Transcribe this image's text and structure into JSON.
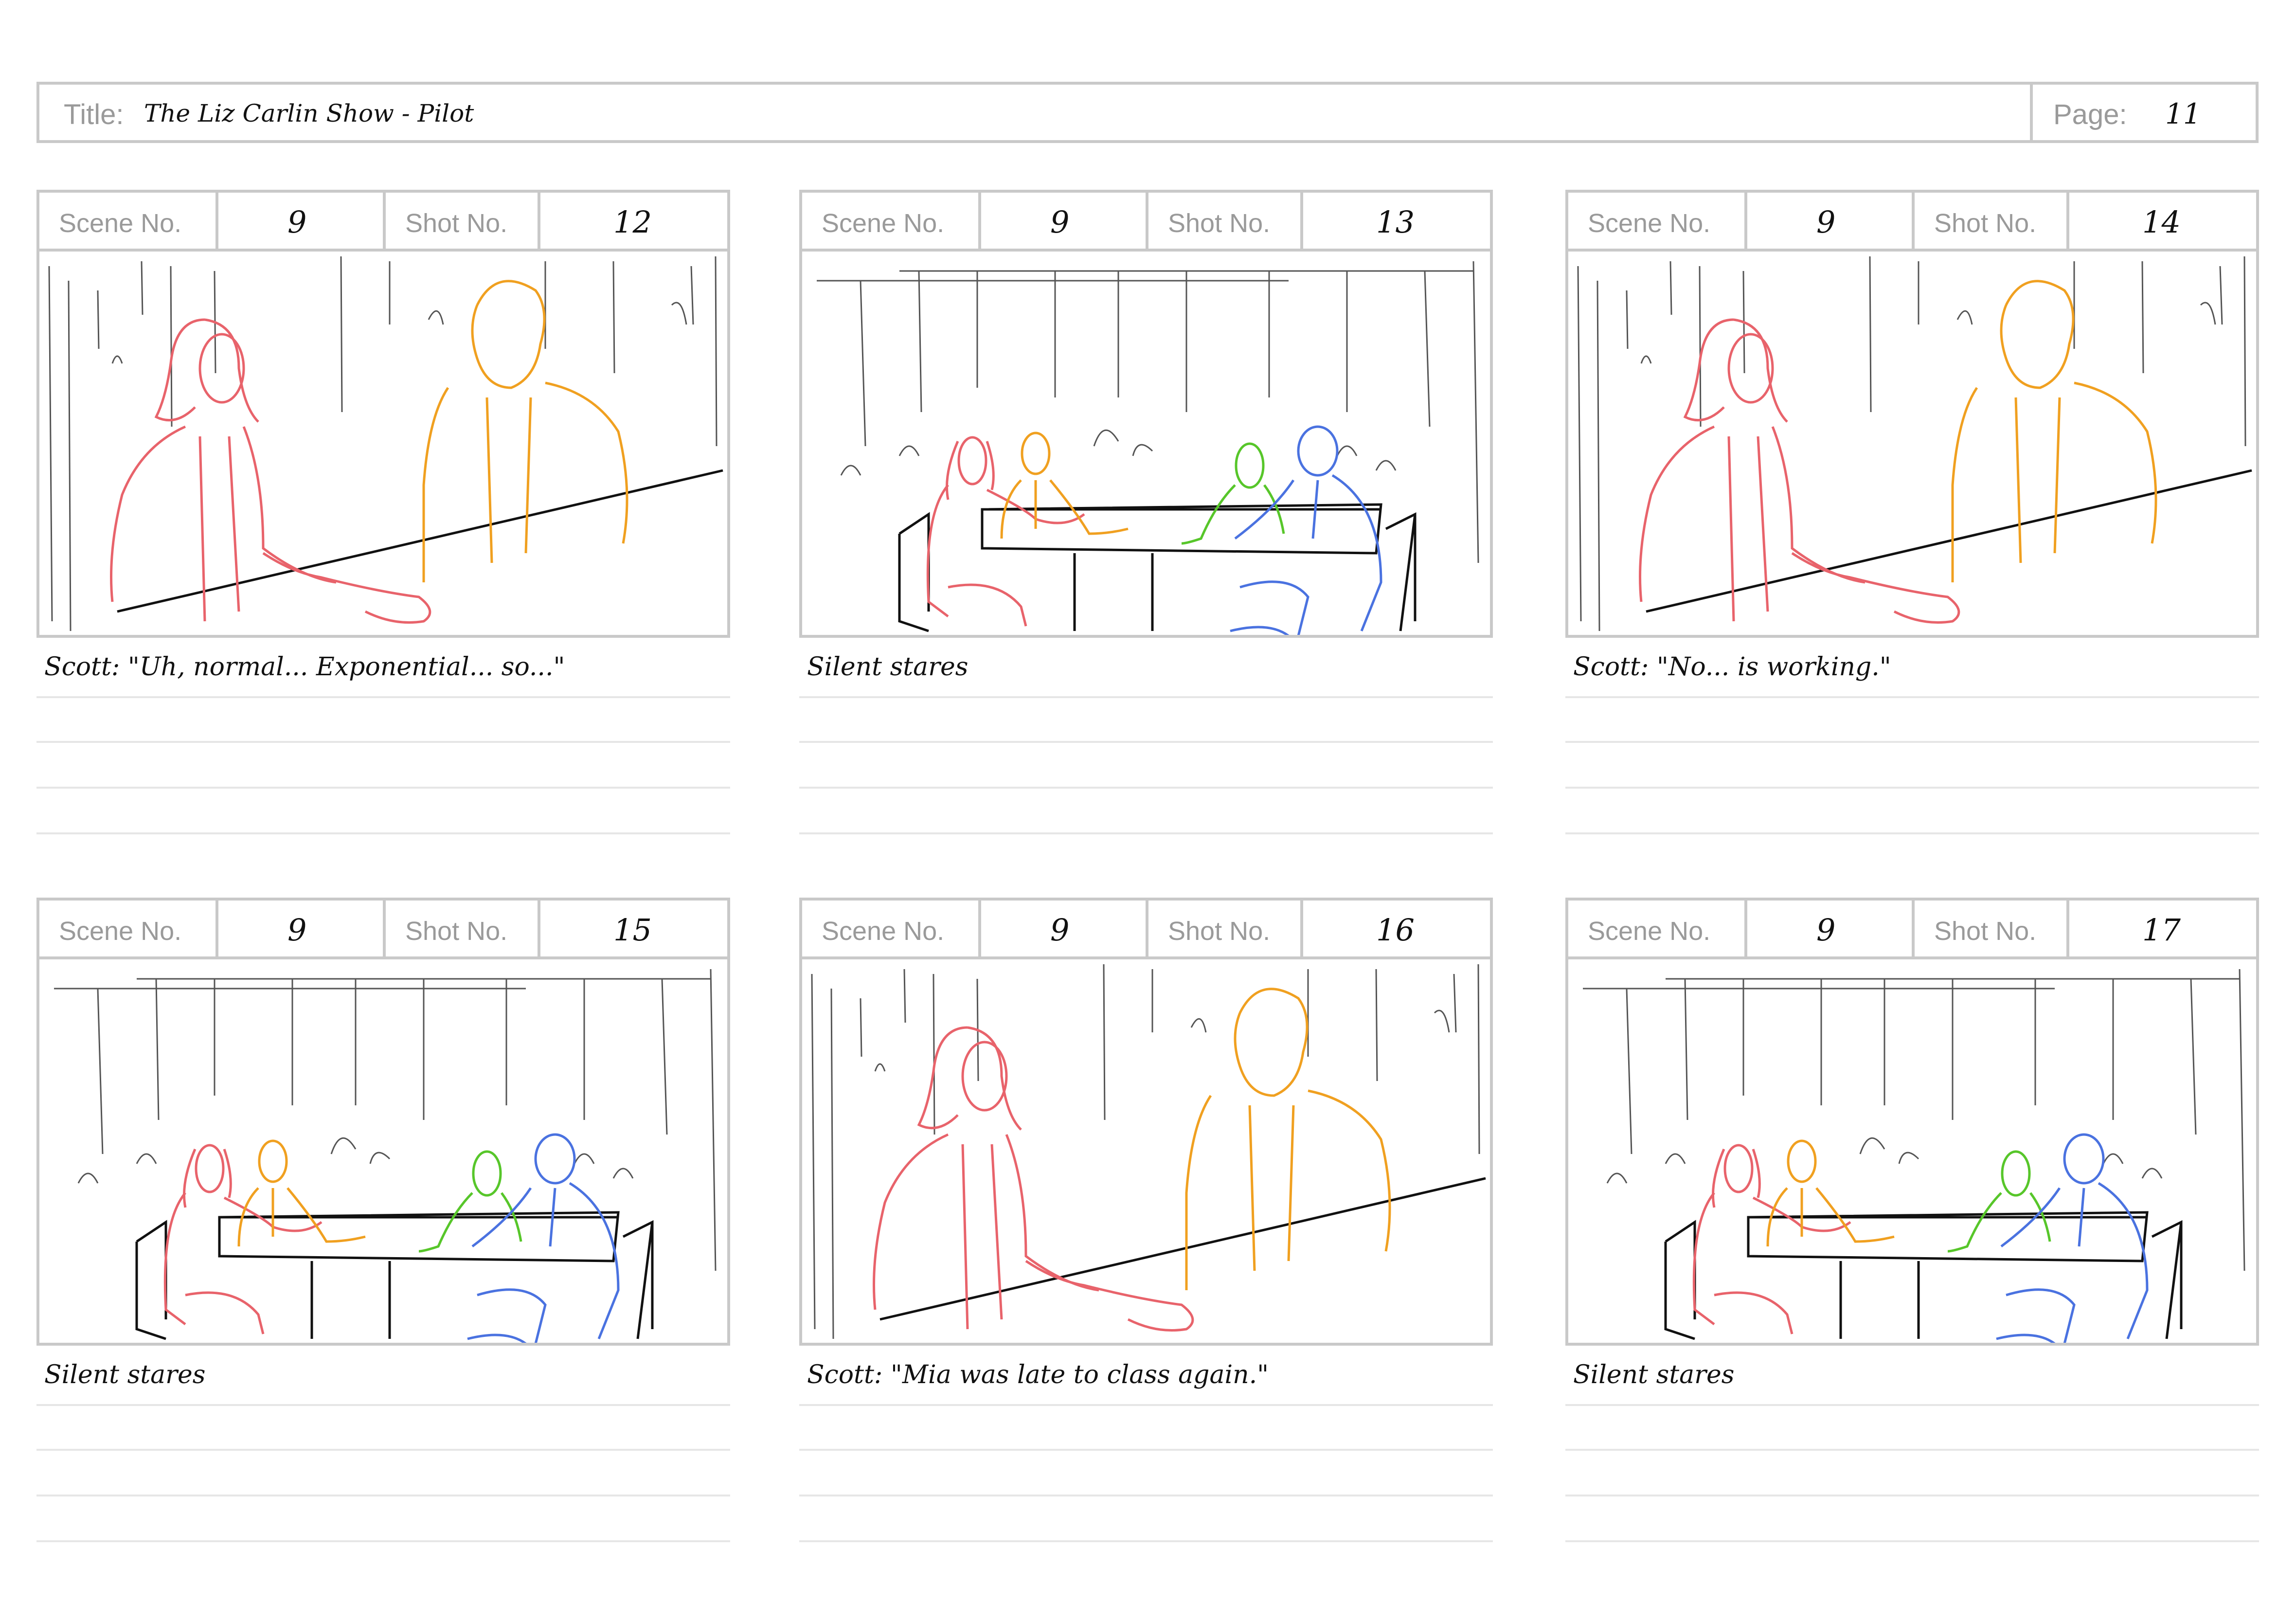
{
  "header": {
    "title_label": "Title:",
    "title_value": "The Liz Carlin Show - Pilot",
    "page_label": "Page:",
    "page_value": "11"
  },
  "labels": {
    "scene": "Scene No.",
    "shot": "Shot No."
  },
  "colors": {
    "border": "#c9c9c9",
    "red_character": "#e8636b",
    "orange_character": "#f0a020",
    "green_character": "#57c62a",
    "blue_character": "#4a72e0",
    "ink": "#111111"
  },
  "panels": [
    {
      "scene": "9",
      "shot": "12",
      "caption": "Scott: \"Uh, normal... Exponential... so...\"",
      "composition": "two-shot-closeup"
    },
    {
      "scene": "9",
      "shot": "13",
      "caption": "Silent stares",
      "composition": "wide-table"
    },
    {
      "scene": "9",
      "shot": "14",
      "caption": "Scott: \"No... is working.\"",
      "composition": "two-shot-closeup"
    },
    {
      "scene": "9",
      "shot": "15",
      "caption": "Silent stares",
      "composition": "wide-table"
    },
    {
      "scene": "9",
      "shot": "16",
      "caption": "Scott: \"Mia was late to class again.\"",
      "composition": "two-shot-closeup"
    },
    {
      "scene": "9",
      "shot": "17",
      "caption": "Silent stares",
      "composition": "wide-table"
    }
  ]
}
